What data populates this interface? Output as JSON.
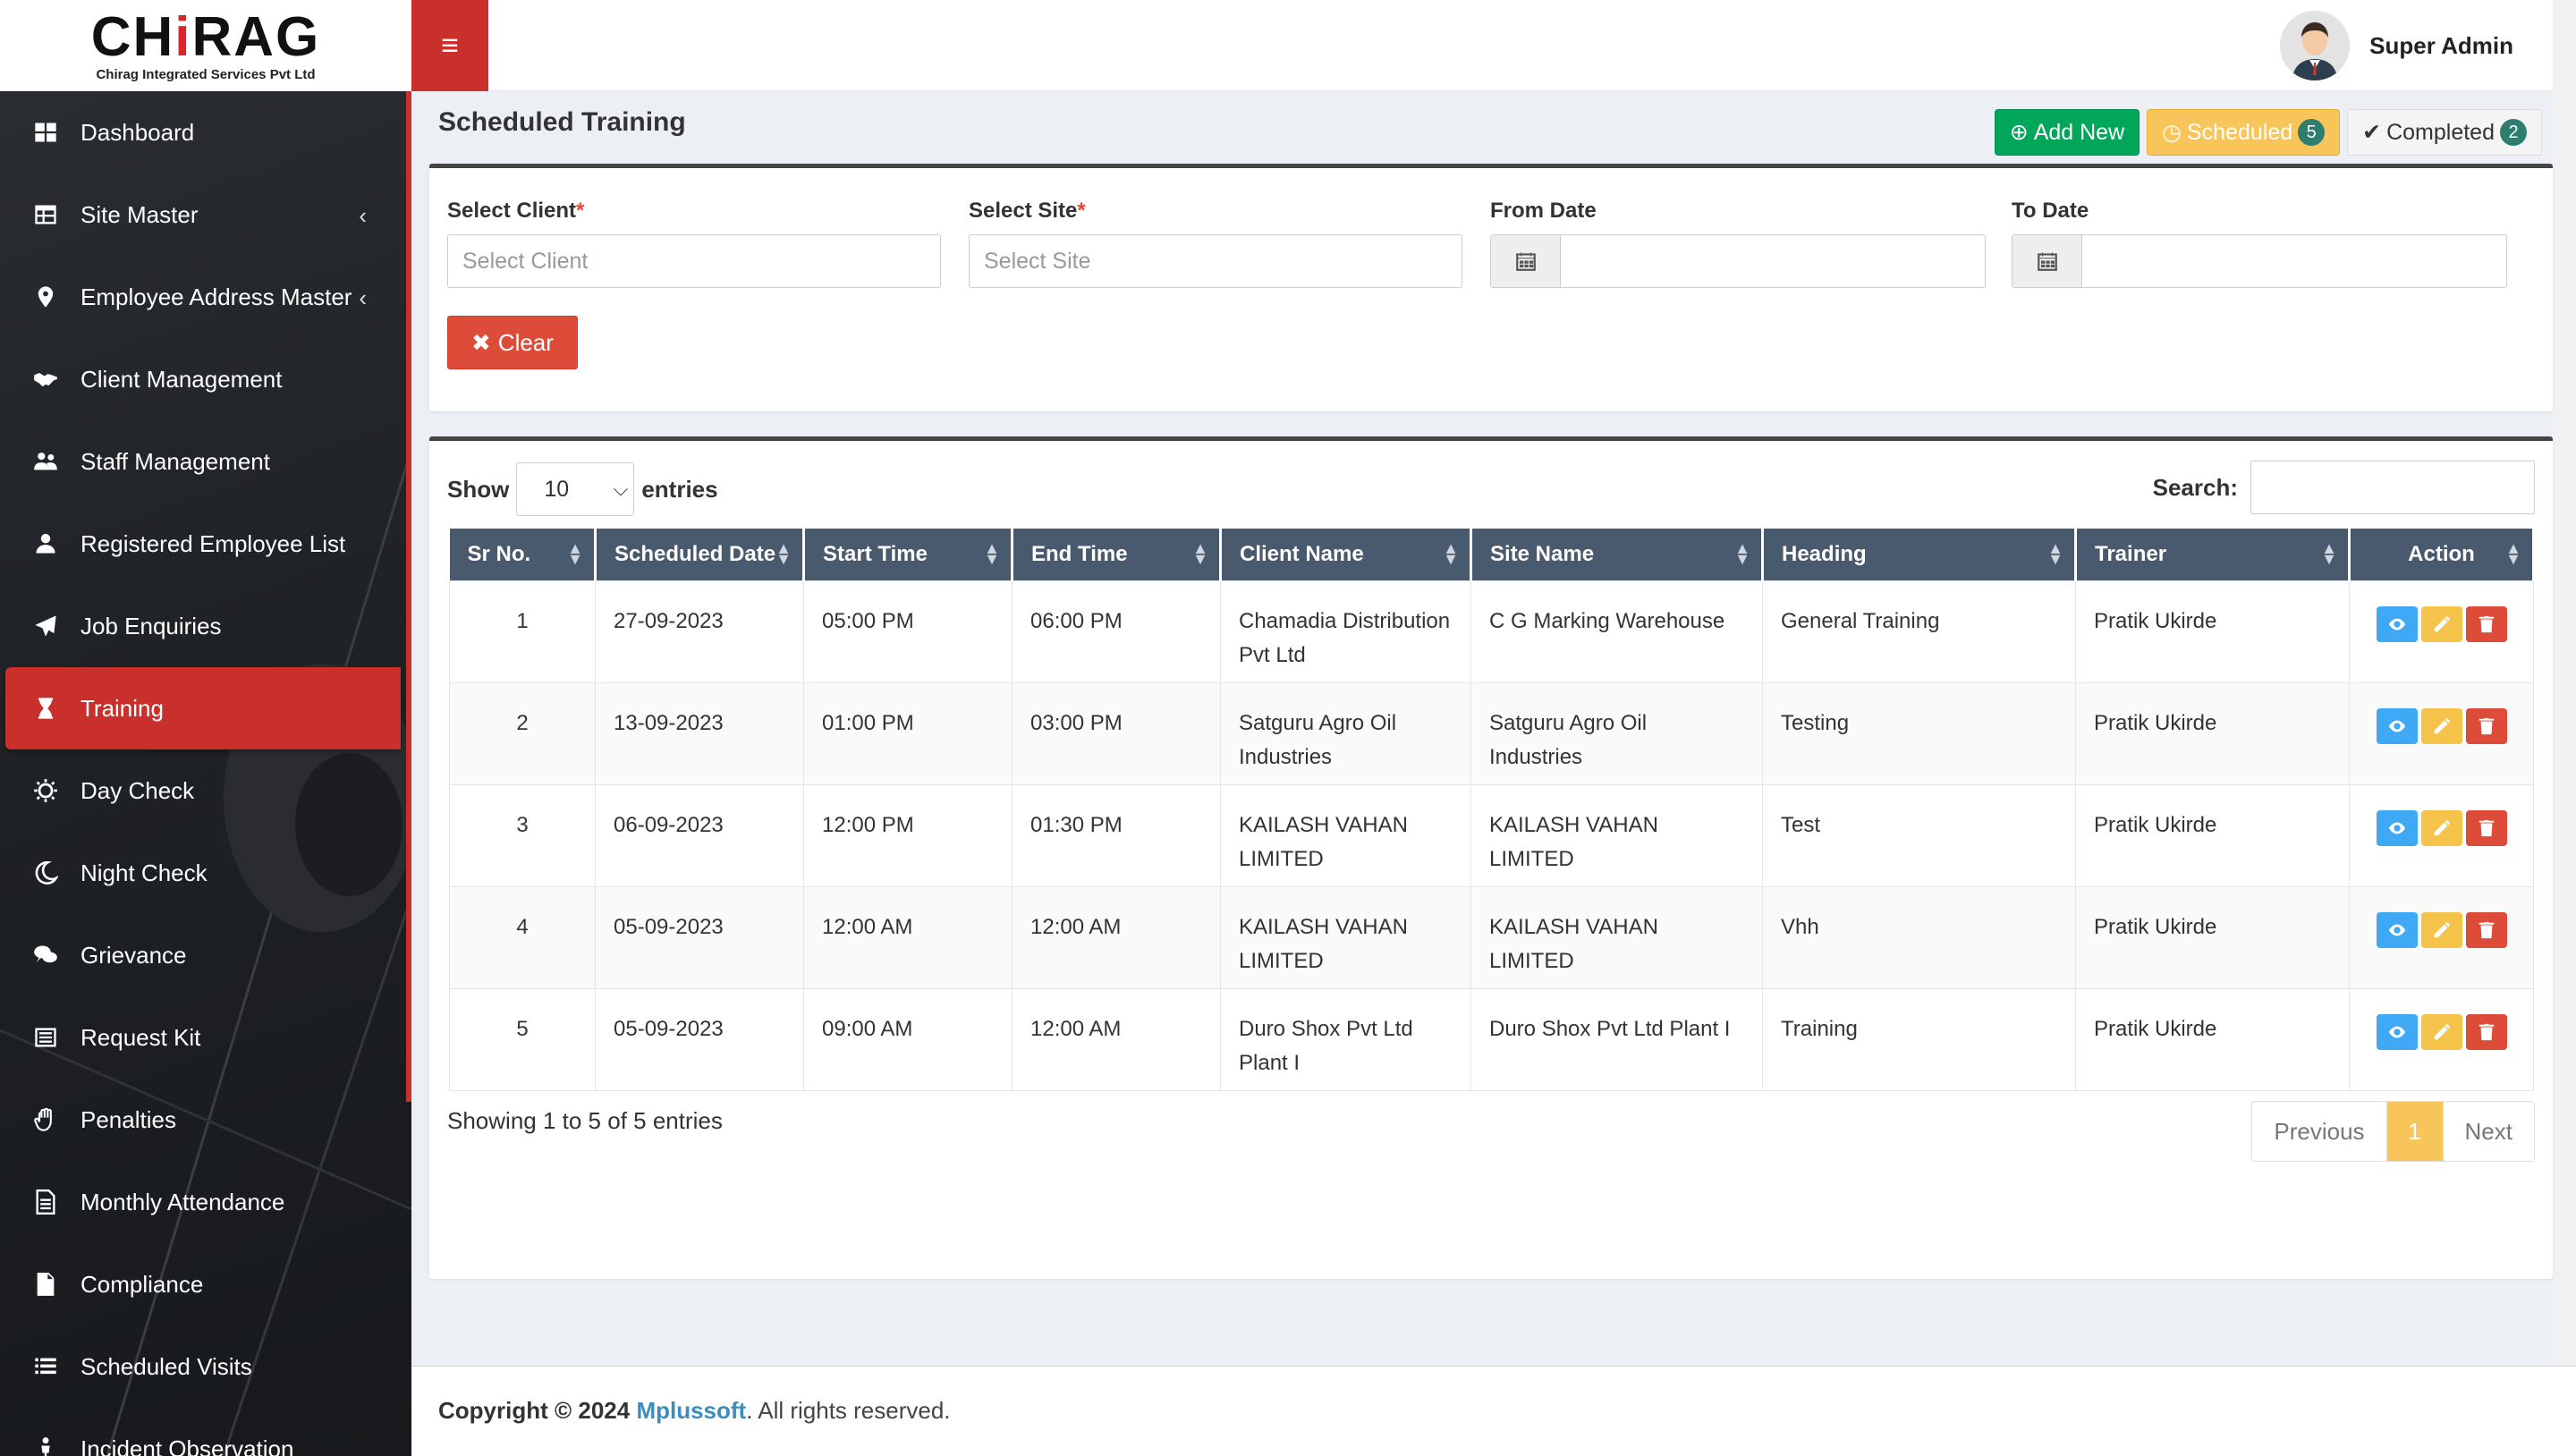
{
  "brand": {
    "logo_pre": "CH",
    "logo_i": "i",
    "logo_post": "RAG",
    "tagline": "Chirag Integrated Services Pvt Ltd"
  },
  "header": {
    "user_name": "Super Admin"
  },
  "sidebar": {
    "items": [
      {
        "label": "Dashboard",
        "icon": "dashboard-icon"
      },
      {
        "label": "Site Master",
        "icon": "table-icon",
        "caret": "‹"
      },
      {
        "label": "Employee Address Master",
        "icon": "map-marker-icon",
        "caret": "‹"
      },
      {
        "label": "Client Management",
        "icon": "handshake-icon"
      },
      {
        "label": "Staff Management",
        "icon": "users-icon"
      },
      {
        "label": "Registered Employee List",
        "icon": "user-icon"
      },
      {
        "label": "Job Enquiries",
        "icon": "paper-plane-icon"
      },
      {
        "label": "Training",
        "icon": "hourglass-icon",
        "active": true
      },
      {
        "label": "Day Check",
        "icon": "sun-icon"
      },
      {
        "label": "Night Check",
        "icon": "moon-icon"
      },
      {
        "label": "Grievance",
        "icon": "comments-icon"
      },
      {
        "label": "Request Kit",
        "icon": "list-alt-icon"
      },
      {
        "label": "Penalties",
        "icon": "hand-icon"
      },
      {
        "label": "Monthly Attendance",
        "icon": "file-text-icon"
      },
      {
        "label": "Compliance",
        "icon": "file-icon"
      },
      {
        "label": "Scheduled Visits",
        "icon": "list-icon"
      },
      {
        "label": "Incident Observation",
        "icon": "person-icon"
      }
    ]
  },
  "page": {
    "title": "Scheduled Training",
    "actions": {
      "add_new": "Add New",
      "scheduled": "Scheduled",
      "scheduled_count": "5",
      "completed": "Completed",
      "completed_count": "2"
    }
  },
  "filters": {
    "client_label": "Select Client",
    "client_placeholder": "Select Client",
    "site_label": "Select Site",
    "site_placeholder": "Select Site",
    "from_label": "From Date",
    "to_label": "To Date",
    "required_mark": "*",
    "clear_label": "Clear"
  },
  "table": {
    "show_label": "Show",
    "entries_label": "entries",
    "page_length": "10",
    "search_label": "Search:",
    "columns": [
      "Sr No.",
      "Scheduled Date",
      "Start Time",
      "End Time",
      "Client Name",
      "Site Name",
      "Heading",
      "Trainer",
      "Action"
    ],
    "rows": [
      {
        "sr": "1",
        "date": "27-09-2023",
        "start": "05:00 PM",
        "end": "06:00 PM",
        "client": "Chamadia Distribution Pvt Ltd",
        "site": "C G Marking Warehouse",
        "heading": "General Training",
        "trainer": "Pratik Ukirde"
      },
      {
        "sr": "2",
        "date": "13-09-2023",
        "start": "01:00 PM",
        "end": "03:00 PM",
        "client": "Satguru Agro Oil Industries",
        "site": "Satguru Agro Oil Industries",
        "heading": "Testing",
        "trainer": "Pratik Ukirde"
      },
      {
        "sr": "3",
        "date": "06-09-2023",
        "start": "12:00 PM",
        "end": "01:30 PM",
        "client": "KAILASH VAHAN LIMITED",
        "site": "KAILASH VAHAN LIMITED",
        "heading": "Test",
        "trainer": "Pratik Ukirde"
      },
      {
        "sr": "4",
        "date": "05-09-2023",
        "start": "12:00 AM",
        "end": "12:00 AM",
        "client": "KAILASH VAHAN LIMITED",
        "site": "KAILASH VAHAN LIMITED",
        "heading": "Vhh",
        "trainer": "Pratik Ukirde"
      },
      {
        "sr": "5",
        "date": "05-09-2023",
        "start": "09:00 AM",
        "end": "12:00 AM",
        "client": "Duro Shox Pvt Ltd Plant I",
        "site": "Duro Shox Pvt Ltd Plant I",
        "heading": "Training",
        "trainer": "Pratik Ukirde"
      }
    ],
    "info": "Showing 1 to 5 of 5 entries",
    "pagination": {
      "previous": "Previous",
      "current": "1",
      "next": "Next"
    }
  },
  "footer": {
    "copyright": "Copyright © 2024",
    "company": "Mplussoft",
    "rights": ". All rights reserved."
  },
  "colors": {
    "accent_red": "#c9302c",
    "sidebar_bg": "#1f2226",
    "table_header": "#4a5a6e",
    "success": "#00a65a",
    "warning": "#f8c55a",
    "danger": "#dd4b39",
    "info": "#3fa9f5"
  }
}
